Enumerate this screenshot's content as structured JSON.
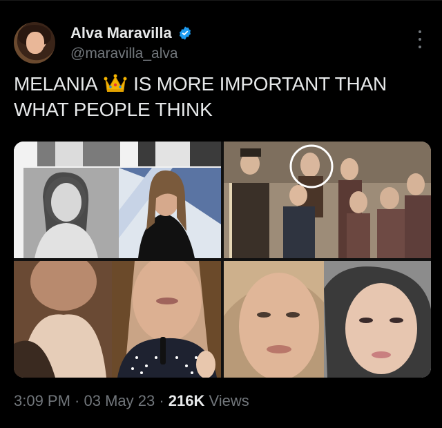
{
  "tweet": {
    "author": {
      "display_name": "Alva Maravilla",
      "handle": "@maravilla_alva",
      "verified": true,
      "verified_color": "#1d9bf0"
    },
    "text_part1": "MELANIA",
    "text_emoji": "crown-emoji",
    "text_part2": "IS MORE IMPORTANT THAN WHAT PEOPLE THINK",
    "media": {
      "images": [
        "top-left-collage",
        "top-right-group-photo",
        "bottom-left-closeup",
        "bottom-right-closeup"
      ]
    },
    "meta": {
      "time": "3:09 PM",
      "separator1": " · ",
      "date": "03 May 23",
      "separator2": " · ",
      "views_count": "216K",
      "views_label": " Views"
    }
  },
  "colors": {
    "background": "#000000",
    "text_primary": "#e7e9ea",
    "text_secondary": "#71767b",
    "accent": "#1d9bf0"
  }
}
